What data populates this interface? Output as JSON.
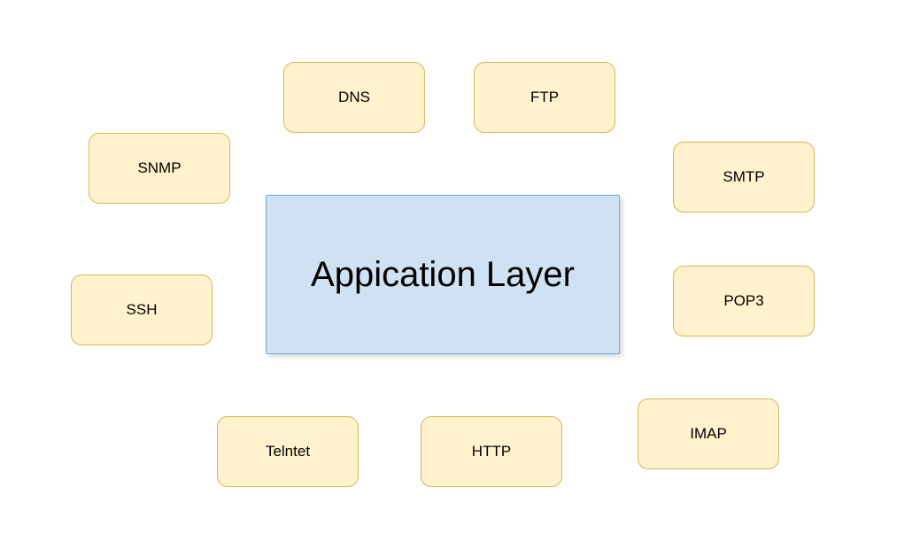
{
  "diagram": {
    "center": {
      "label": "Appication Layer"
    },
    "protocols": {
      "dns": "DNS",
      "ftp": "FTP",
      "snmp": "SNMP",
      "smtp": "SMTP",
      "ssh": "SSH",
      "pop3": "POP3",
      "telnet": "Telntet",
      "http": "HTTP",
      "imap": "IMAP"
    }
  }
}
